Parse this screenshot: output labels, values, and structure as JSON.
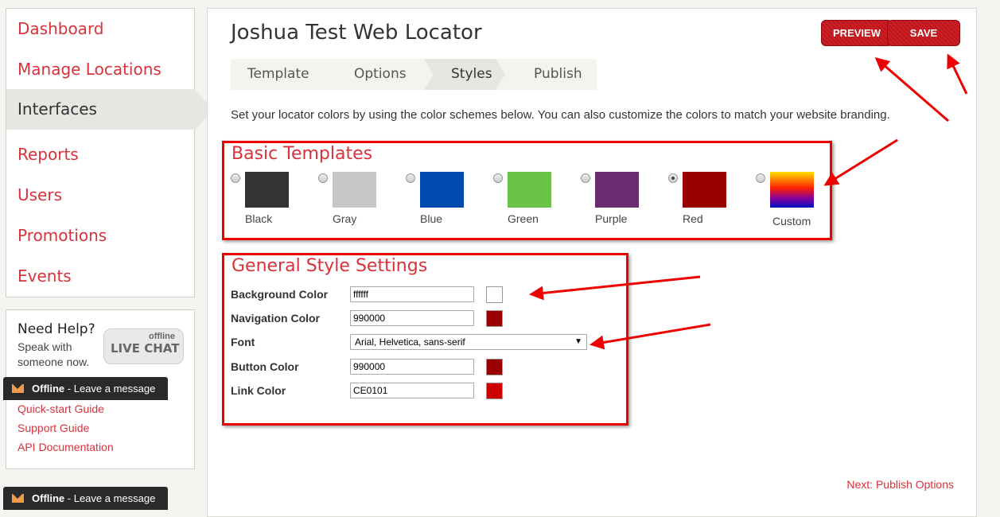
{
  "sidebar": {
    "items": [
      {
        "label": "Dashboard"
      },
      {
        "label": "Manage Locations"
      },
      {
        "label": "Interfaces",
        "active": true
      },
      {
        "label": "Reports"
      },
      {
        "label": "Users"
      },
      {
        "label": "Promotions"
      },
      {
        "label": "Events"
      }
    ]
  },
  "help": {
    "title": "Need Help?",
    "subtitle": "Speak with someone now.",
    "chat_status": "offline",
    "chat_label": "LIVE CHAT",
    "links": [
      "Quick-start Guide",
      "Support Guide",
      "API Documentation"
    ]
  },
  "offline_bar": {
    "status": "Offline",
    "message": " - Leave a message"
  },
  "header": {
    "title": "Joshua Test Web Locator",
    "preview_label": "PREVIEW",
    "save_label": "SAVE"
  },
  "steps": [
    {
      "label": "Template"
    },
    {
      "label": "Options"
    },
    {
      "label": "Styles",
      "current": true
    },
    {
      "label": "Publish"
    }
  ],
  "intro": "Set your locator colors by using the color schemes below. You can also customize the colors to match your website branding.",
  "templates": {
    "title": "Basic Templates",
    "items": [
      {
        "label": "Black",
        "color": "#333333"
      },
      {
        "label": "Gray",
        "color": "#c6c6c6"
      },
      {
        "label": "Blue",
        "color": "#004aad"
      },
      {
        "label": "Green",
        "color": "#6ac44a"
      },
      {
        "label": "Purple",
        "color": "#6a2c6e"
      },
      {
        "label": "Red",
        "color": "#990000",
        "selected": true
      },
      {
        "label": "Custom",
        "color": "gradient"
      }
    ]
  },
  "general": {
    "title": "General Style Settings",
    "background_label": "Background Color",
    "background_value": "ffffff",
    "navigation_label": "Navigation Color",
    "navigation_value": "990000",
    "font_label": "Font",
    "font_value": "Arial, Helvetica, sans-serif",
    "button_label": "Button Color",
    "button_value": "990000",
    "link_label": "Link Color",
    "link_value": "CE0101"
  },
  "next_link": "Next: Publish Options",
  "colors": {
    "accent": "#d8323a",
    "annotation": "#e00000"
  }
}
